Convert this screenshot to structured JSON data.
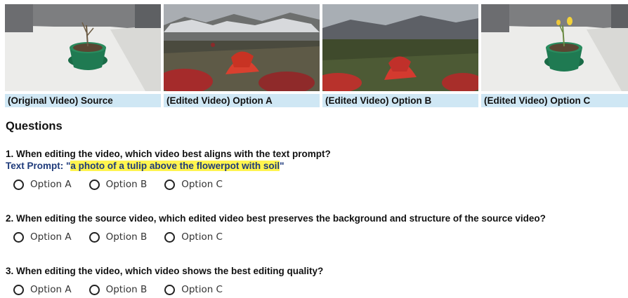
{
  "videos": [
    {
      "caption": "(Original Video) Source",
      "scene": "white-table-flowerpot"
    },
    {
      "caption": "(Edited Video) Option A",
      "scene": "mountain-red-tents"
    },
    {
      "caption": "(Edited Video) Option B",
      "scene": "mountain-red-tent"
    },
    {
      "caption": "(Edited Video) Option C",
      "scene": "white-table-tulip-flowerpot"
    }
  ],
  "questions_title": "Questions",
  "questions": [
    {
      "text": "1. When editing the video, which video best aligns with the text prompt?",
      "prompt_label": "Text Prompt: \"",
      "prompt_text": "a photo of a tulip above the flowerpot with soil",
      "prompt_end": "\"",
      "options": [
        "Option A",
        "Option B",
        "Option C"
      ]
    },
    {
      "text": "2. When editing the source video, which edited video best preserves the background and structure of the source video?",
      "options": [
        "Option A",
        "Option B",
        "Option C"
      ]
    },
    {
      "text": "3. When editing the video, which video shows the best editing quality?",
      "options": [
        "Option A",
        "Option B",
        "Option C"
      ]
    }
  ],
  "colors": {
    "caption_bg": "#cfe7f4",
    "prompt_text": "#1e3a7a",
    "highlight": "#fff44f"
  }
}
